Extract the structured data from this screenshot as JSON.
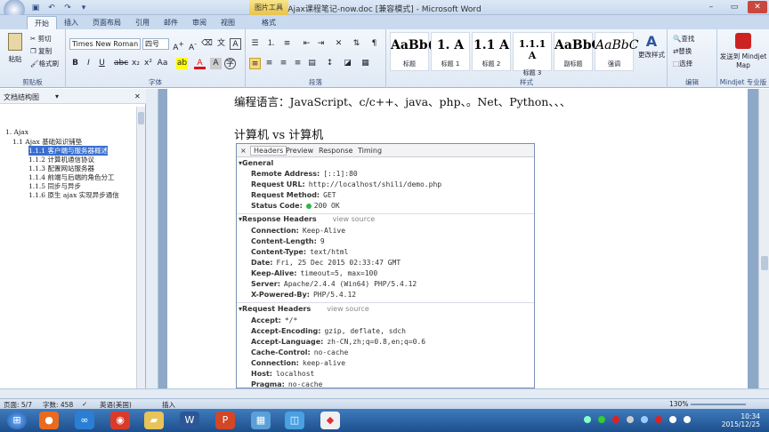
{
  "window": {
    "title": "Ajax课程笔记-now.doc [兼容模式] - Microsoft Word",
    "context_tab": "图片工具"
  },
  "tabs": [
    "开始",
    "插入",
    "页面布局",
    "引用",
    "邮件",
    "审阅",
    "视图",
    "格式"
  ],
  "ribbon": {
    "clipboard": {
      "paste": "粘贴",
      "cut": "剪切",
      "copy": "复制",
      "format_painter": "格式刷",
      "label": "剪贴板"
    },
    "font": {
      "name": "Times New Roman",
      "size": "四号",
      "label": "字体"
    },
    "paragraph": {
      "label": "段落"
    },
    "styles": {
      "label": "样式",
      "items": [
        {
          "preview": "AaBb(",
          "name": "标题"
        },
        {
          "preview": "1. A",
          "name": "标题 1"
        },
        {
          "preview": "1.1 A",
          "name": "标题 2"
        },
        {
          "preview": "1.1.1 A",
          "name": "标题 3"
        },
        {
          "preview": "AaBbC",
          "name": "副标题"
        },
        {
          "preview": "AaBbC",
          "name": "强调"
        }
      ],
      "change_styles": "更改样式"
    },
    "editing": {
      "find": "查找",
      "replace": "替换",
      "select": "选择",
      "label": "编辑"
    },
    "mindjet": {
      "send": "发送到 Mindjet Map",
      "label": "Mindjet 专业版"
    }
  },
  "nav": {
    "title": "文档结构图",
    "items": [
      {
        "text": "1. Ajax",
        "level": 0
      },
      {
        "text": "1.1 Ajax 基础知识铺垫",
        "level": 1
      },
      {
        "text": "1.1.1 客户端与服务器概述",
        "level": 2,
        "selected": true
      },
      {
        "text": "1.1.2 计算机通信协议",
        "level": 2
      },
      {
        "text": "1.1.3 配置网站服务器",
        "level": 2
      },
      {
        "text": "1.1.4 前端与后端的角色分工",
        "level": 2
      },
      {
        "text": "1.1.5 同步与异步",
        "level": 2
      },
      {
        "text": "1.1.6 原生 ajax 实现异步通信",
        "level": 2
      }
    ]
  },
  "doc": {
    "line1": "编程语言：JavaScript、c/c++、java、php、。Net、Python、、、",
    "line2": "计算机        vs         计算机"
  },
  "devtools": {
    "tabs": [
      "×",
      "Headers",
      "Preview",
      "Response",
      "Timing"
    ],
    "general": {
      "title": "General",
      "rows": [
        {
          "k": "Remote Address:",
          "v": "[::1]:80"
        },
        {
          "k": "Request URL:",
          "v": "http://localhost/shili/demo.php"
        },
        {
          "k": "Request Method:",
          "v": "GET"
        },
        {
          "k": "Status Code:",
          "v": "200 OK"
        }
      ]
    },
    "response": {
      "title": "Response Headers",
      "view_source": "view source",
      "rows": [
        {
          "k": "Connection:",
          "v": "Keep-Alive"
        },
        {
          "k": "Content-Length:",
          "v": "9"
        },
        {
          "k": "Content-Type:",
          "v": "text/html"
        },
        {
          "k": "Date:",
          "v": "Fri, 25 Dec 2015 02:33:47 GMT"
        },
        {
          "k": "Keep-Alive:",
          "v": "timeout=5, max=100"
        },
        {
          "k": "Server:",
          "v": "Apache/2.4.4 (Win64) PHP/5.4.12"
        },
        {
          "k": "X-Powered-By:",
          "v": "PHP/5.4.12"
        }
      ]
    },
    "request": {
      "title": "Request Headers",
      "view_source": "view source",
      "rows": [
        {
          "k": "Accept:",
          "v": "*/*"
        },
        {
          "k": "Accept-Encoding:",
          "v": "gzip, deflate, sdch"
        },
        {
          "k": "Accept-Language:",
          "v": "zh-CN,zh;q=0.8,en;q=0.6"
        },
        {
          "k": "Cache-Control:",
          "v": "no-cache"
        },
        {
          "k": "Connection:",
          "v": "keep-alive"
        },
        {
          "k": "Host:",
          "v": "localhost"
        },
        {
          "k": "Pragma:",
          "v": "no-cache"
        }
      ]
    }
  },
  "status": {
    "page": "页面: 5/7",
    "words": "字数: 458",
    "lang": "英语(美国)",
    "mode": "插入",
    "zoom": "130%"
  },
  "clock": {
    "time": "10:34",
    "date": "2015/12/25"
  },
  "colors": {
    "accent": "#2b579a",
    "status_ok": "#2fb64a",
    "selection": "#3a6fcf"
  }
}
